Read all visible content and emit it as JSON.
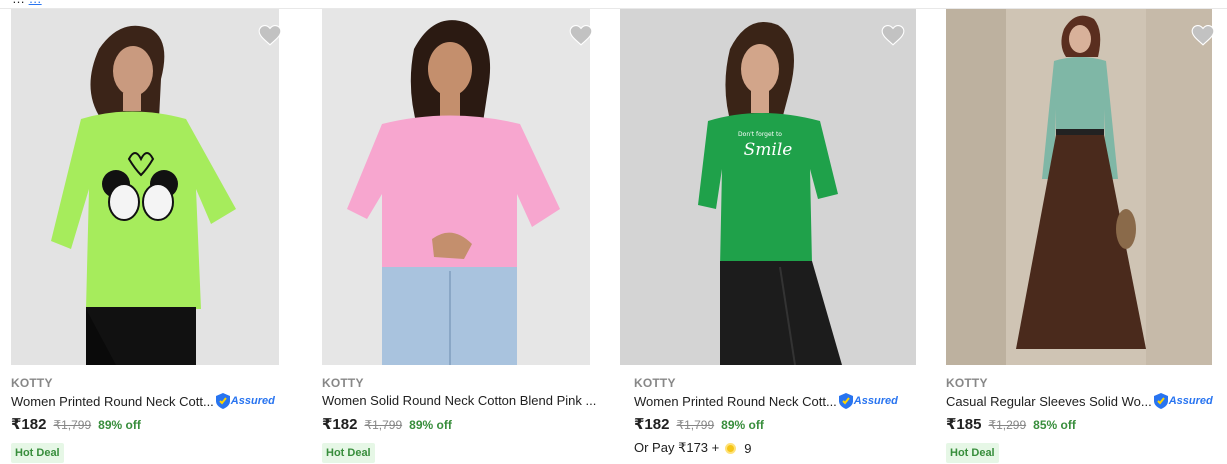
{
  "top_strip": {
    "text_before": "…",
    "link_text": "…"
  },
  "products": [
    {
      "brand": "KOTTY",
      "title": "Women Printed Round Neck Cott...",
      "assured": true,
      "assured_label": "Assured",
      "price": "₹182",
      "mrp": "₹1,799",
      "discount": "89% off",
      "badge": "Hot Deal",
      "pay_text": null,
      "pay_coins": null,
      "shirt_color": "#a6ec5c"
    },
    {
      "brand": "KOTTY",
      "title": "Women Solid Round Neck Cotton Blend Pink ...",
      "assured": false,
      "assured_label": null,
      "price": "₹182",
      "mrp": "₹1,799",
      "discount": "89% off",
      "badge": "Hot Deal",
      "pay_text": null,
      "pay_coins": null,
      "shirt_color": "#f7a6cf"
    },
    {
      "brand": "KOTTY",
      "title": "Women Printed Round Neck Cott...",
      "assured": true,
      "assured_label": "Assured",
      "price": "₹182",
      "mrp": "₹1,799",
      "discount": "89% off",
      "badge": null,
      "pay_text": "Or Pay ₹173 +",
      "pay_coins": "9",
      "shirt_color": "#1fa14a",
      "print_small": "Don't forget to",
      "print_script": "Smile"
    },
    {
      "brand": "KOTTY",
      "title": "Casual Regular Sleeves Solid Wo...",
      "assured": true,
      "assured_label": "Assured",
      "price": "₹185",
      "mrp": "₹1,299",
      "discount": "85% off",
      "badge": "Hot Deal",
      "pay_text": null,
      "pay_coins": null,
      "shirt_color": "#7fb7a6"
    }
  ],
  "colors": {
    "discount_green": "#388e3c",
    "assured_blue": "#2874f0",
    "wishlist_grey": "#c2c2c2",
    "deal_bg": "#e6f7e6"
  }
}
